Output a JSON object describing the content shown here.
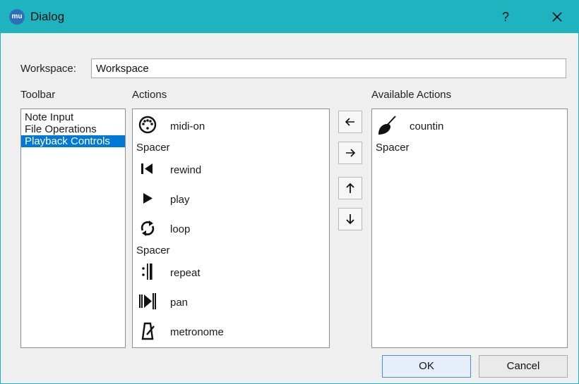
{
  "window": {
    "app_icon": "mu",
    "title": "Dialog",
    "help_label": "?"
  },
  "workspace": {
    "label": "Workspace:",
    "value": "Workspace"
  },
  "toolbar": {
    "header": "Toolbar",
    "items": [
      "Note Input",
      "File Operations",
      "Playback Controls"
    ],
    "selected": "Playback Controls"
  },
  "actions": {
    "header": "Actions",
    "items": [
      {
        "icon": "midi-on-icon",
        "label": "midi-on"
      },
      {
        "spacer": "Spacer"
      },
      {
        "icon": "rewind-icon",
        "label": "rewind"
      },
      {
        "icon": "play-icon",
        "label": "play"
      },
      {
        "icon": "loop-icon",
        "label": "loop"
      },
      {
        "spacer": "Spacer"
      },
      {
        "icon": "repeat-icon",
        "label": "repeat"
      },
      {
        "icon": "pan-icon",
        "label": "pan"
      },
      {
        "icon": "metronome-icon",
        "label": "metronome"
      }
    ]
  },
  "available": {
    "header": "Available Actions",
    "items": [
      {
        "icon": "countin-icon",
        "label": "countin"
      },
      {
        "spacer": "Spacer"
      }
    ]
  },
  "move_buttons": [
    "left-arrow-icon",
    "right-arrow-icon",
    "up-arrow-icon",
    "down-arrow-icon"
  ],
  "buttons": {
    "ok": "OK",
    "cancel": "Cancel"
  },
  "colors": {
    "title_bar": "#1fb3c0",
    "selection": "#0078d7",
    "ok_border": "#4a90d9"
  }
}
